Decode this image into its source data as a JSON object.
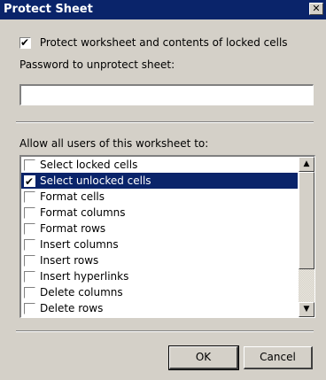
{
  "window": {
    "title": "Protect Sheet",
    "close_glyph": "✕"
  },
  "protect_checkbox": {
    "label": "Protect worksheet and contents of locked cells",
    "checked": true
  },
  "password": {
    "label": "Password to unprotect sheet:",
    "value": ""
  },
  "permissions": {
    "label": "Allow all users of this worksheet to:",
    "items": [
      {
        "label": "Select locked cells",
        "checked": false,
        "selected": false
      },
      {
        "label": "Select unlocked cells",
        "checked": true,
        "selected": true
      },
      {
        "label": "Format cells",
        "checked": false,
        "selected": false
      },
      {
        "label": "Format columns",
        "checked": false,
        "selected": false
      },
      {
        "label": "Format rows",
        "checked": false,
        "selected": false
      },
      {
        "label": "Insert columns",
        "checked": false,
        "selected": false
      },
      {
        "label": "Insert rows",
        "checked": false,
        "selected": false
      },
      {
        "label": "Insert hyperlinks",
        "checked": false,
        "selected": false
      },
      {
        "label": "Delete columns",
        "checked": false,
        "selected": false
      },
      {
        "label": "Delete rows",
        "checked": false,
        "selected": false
      }
    ]
  },
  "icons": {
    "check": "✔",
    "scroll_up": "▲",
    "scroll_down": "▼"
  },
  "buttons": {
    "ok": "OK",
    "cancel": "Cancel"
  },
  "colors": {
    "titlebar": "#0a246a",
    "dialog_bg": "#d4d0c8",
    "selection": "#0a246a"
  }
}
